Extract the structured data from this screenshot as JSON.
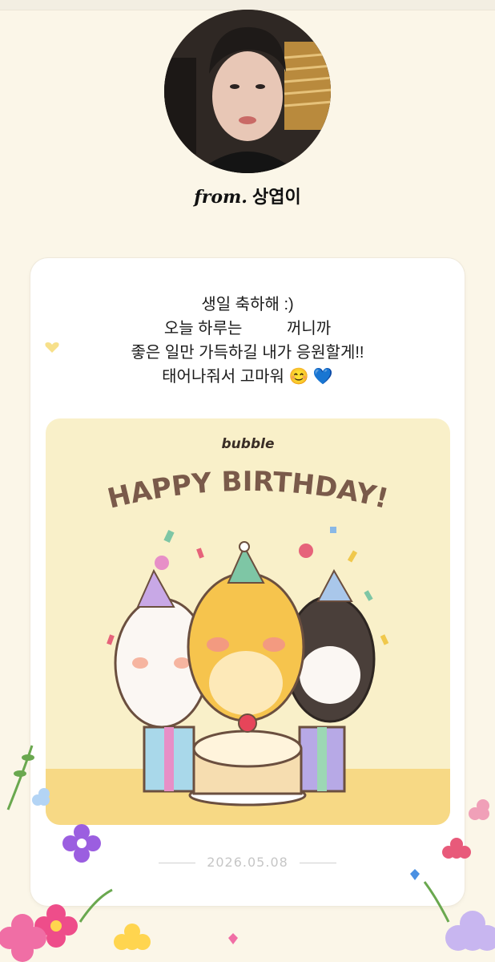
{
  "sender": {
    "prefix": "from.",
    "name": "상엽이"
  },
  "message_lines": [
    "생일 축하해 :)",
    "오늘 하루는          꺼니까",
    "좋은 일만 가득하길 내가 응원할게!!",
    "태어나줘서 고마워 😊 💙"
  ],
  "card_image": {
    "logo": "bubble",
    "headline": "HAPPY BIRTHDAY!",
    "illustration": "three-dogs-party-icon"
  },
  "date": "2026.05.08",
  "colors": {
    "background": "#fbf6e8",
    "card": "#ffffff",
    "image_bg": "#f9f0c9",
    "headline": "#7a5a4a",
    "date_text": "#c6c6c6"
  }
}
